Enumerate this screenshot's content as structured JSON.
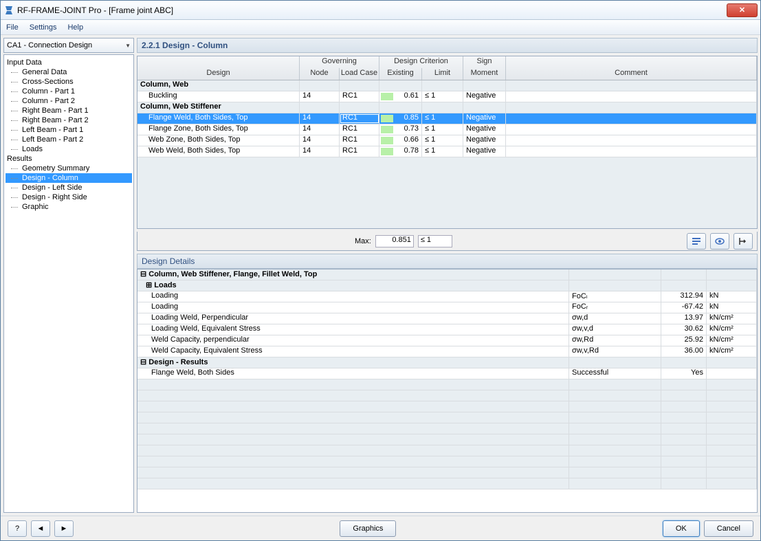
{
  "window": {
    "title": "RF-FRAME-JOINT Pro - [Frame joint ABC]"
  },
  "menu": {
    "file": "File",
    "settings": "Settings",
    "help": "Help"
  },
  "sidebar": {
    "combo": "CA1 - Connection Design",
    "input_label": "Input Data",
    "results_label": "Results",
    "input_items": [
      "General Data",
      "Cross-Sections",
      "Column - Part 1",
      "Column - Part 2",
      "Right Beam - Part 1",
      "Right Beam - Part 2",
      "Left Beam - Part 1",
      "Left Beam - Part 2",
      "Loads"
    ],
    "result_items": [
      "Geometry Summary",
      "Design - Column",
      "Design - Left Side",
      "Design - Right Side",
      "Graphic"
    ]
  },
  "panel": {
    "title": "2.2.1 Design - Column"
  },
  "grid": {
    "h_design": "Design",
    "h_gov": "Governing",
    "h_node": "Node",
    "h_lc": "Load Case",
    "h_crit": "Design Criterion",
    "h_exist": "Existing",
    "h_limit": "Limit",
    "h_sign": "Sign",
    "h_moment": "Moment",
    "h_comment": "Comment",
    "groups": [
      {
        "title": "Column, Web",
        "rows": [
          {
            "design": "Buckling",
            "node": "14",
            "lc": "RC1",
            "exist": "0.61",
            "limit": "≤ 1",
            "sign": "Negative"
          }
        ]
      },
      {
        "title": "Column, Web Stiffener",
        "rows": [
          {
            "design": "Flange Weld, Both Sides, Top",
            "node": "14",
            "lc": "RC1",
            "exist": "0.85",
            "limit": "≤ 1",
            "sign": "Negative",
            "sel": true
          },
          {
            "design": "Flange Zone, Both Sides, Top",
            "node": "14",
            "lc": "RC1",
            "exist": "0.73",
            "limit": "≤ 1",
            "sign": "Negative"
          },
          {
            "design": "Web Zone, Both Sides, Top",
            "node": "14",
            "lc": "RC1",
            "exist": "0.66",
            "limit": "≤ 1",
            "sign": "Negative"
          },
          {
            "design": "Web Weld, Both Sides, Top",
            "node": "14",
            "lc": "RC1",
            "exist": "0.78",
            "limit": "≤ 1",
            "sign": "Negative"
          }
        ]
      }
    ],
    "max_label": "Max:",
    "max_value": "0.851",
    "max_limit": "≤ 1"
  },
  "details": {
    "title": "Design Details",
    "header": "⊟ Column, Web Stiffener, Flange, Fillet Weld, Top",
    "loads_header": "⊞ Loads",
    "rows": [
      {
        "label": "Loading",
        "sym": "FoCₗ",
        "val": "312.94",
        "unit": "kN"
      },
      {
        "label": "Loading",
        "sym": "FoCᵣ",
        "val": "-67.42",
        "unit": "kN"
      },
      {
        "label": "Loading Weld, Perpendicular",
        "sym": "σw,d",
        "val": "13.97",
        "unit": "kN/cm²"
      },
      {
        "label": "Loading Weld, Equivalent Stress",
        "sym": "σw,v,d",
        "val": "30.62",
        "unit": "kN/cm²"
      },
      {
        "label": "Weld Capacity, perpendicular",
        "sym": "σw,Rd",
        "val": "25.92",
        "unit": "kN/cm²"
      },
      {
        "label": "Weld Capacity, Equivalent Stress",
        "sym": "σw,v,Rd",
        "val": "36.00",
        "unit": "kN/cm²"
      }
    ],
    "results_header": "⊟ Design - Results",
    "result_row": {
      "label": "Flange Weld, Both Sides",
      "sym": "Successful",
      "val": "Yes",
      "unit": ""
    }
  },
  "buttons": {
    "graphics": "Graphics",
    "ok": "OK",
    "cancel": "Cancel"
  }
}
